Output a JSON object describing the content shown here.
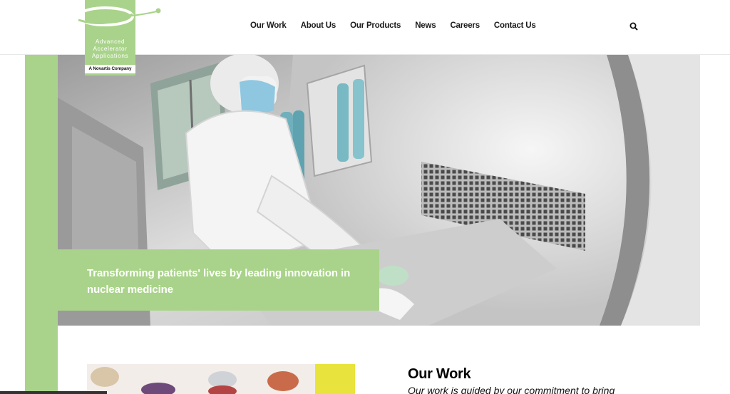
{
  "logo": {
    "lines": [
      "Advanced",
      "Accelerator",
      "Applications"
    ],
    "tagline": "A Novartis Company"
  },
  "nav": {
    "items": [
      "Our Work",
      "About Us",
      "Our Products",
      "News",
      "Careers",
      "Contact Us"
    ],
    "search_icon": "search-icon"
  },
  "hero": {
    "caption": "Transforming patients' lives by leading innovation in nuclear medicine"
  },
  "work": {
    "title": "Our Work",
    "text": "Our work is guided by our commitment to bring"
  },
  "colors": {
    "accent": "#a9d38a",
    "text": "#1a1a1a"
  }
}
